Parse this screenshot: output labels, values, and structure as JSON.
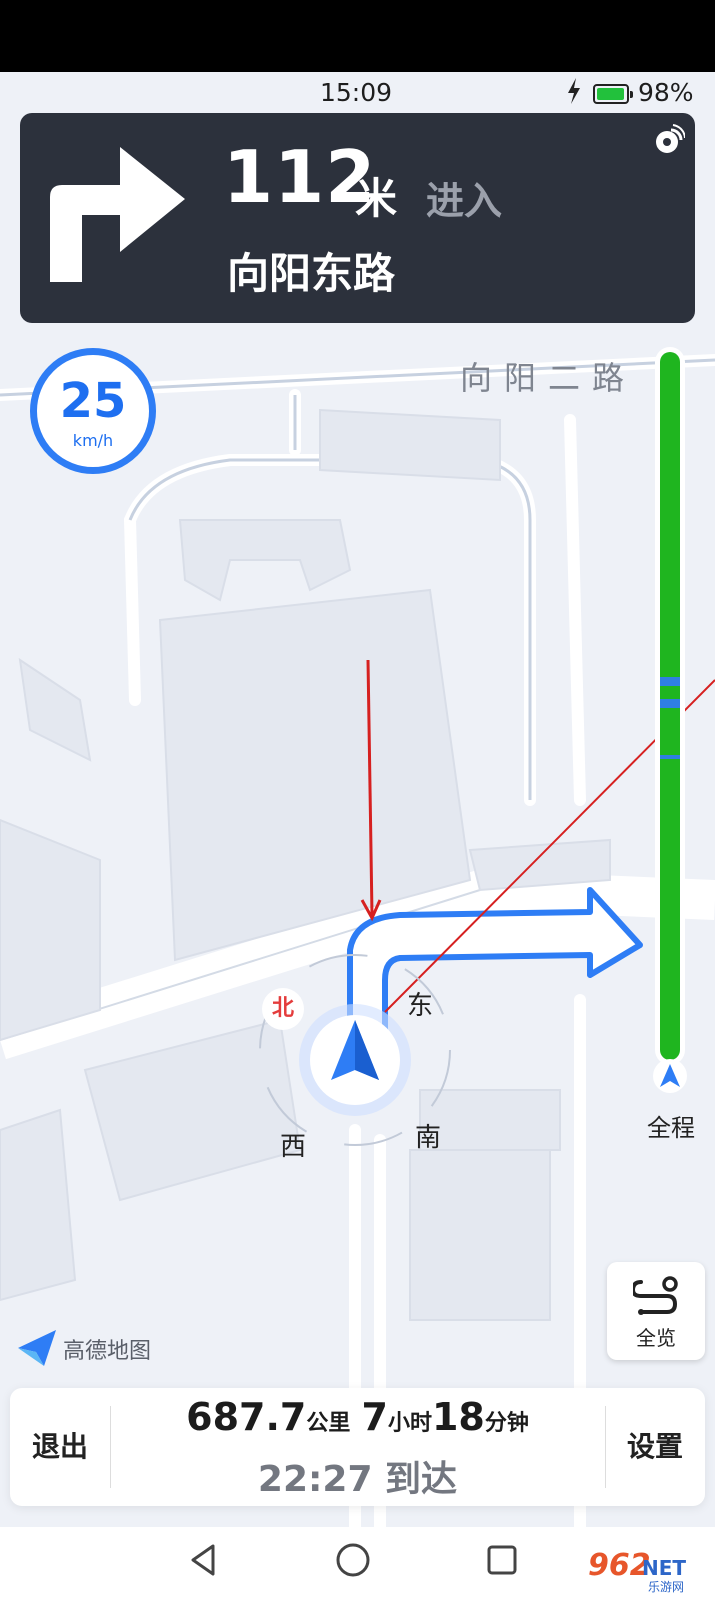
{
  "status_bar": {
    "time": "15:09",
    "battery": "98%",
    "battery_level": 0.98
  },
  "nav_instruction": {
    "distance": "112",
    "distance_unit": "米",
    "action": "进入",
    "road": "向阳东路",
    "turn_icon": "turn-right-arrow-icon",
    "voice_icon": "voice-broadcast-icon"
  },
  "speed": {
    "value": "25",
    "unit": "km/h"
  },
  "map": {
    "street_label": "向阳二路"
  },
  "compass": {
    "north": "北",
    "east": "东",
    "south": "南",
    "west": "西"
  },
  "route_progress": {
    "label": "全程"
  },
  "brand": {
    "logo_text": "高德地图"
  },
  "overview_button": {
    "label": "全览",
    "icon": "route-overview-icon"
  },
  "trip_summary": {
    "distance": "687.7",
    "distance_unit": "公里",
    "hours": "7",
    "hours_unit": "小时",
    "minutes": "18",
    "minutes_unit": "分钟",
    "arrival": "22:27 到达"
  },
  "buttons": {
    "exit": "退出",
    "settings": "设置"
  },
  "watermark": {
    "brand": "962",
    "suffix": "NET",
    "caption": "乐游网"
  },
  "colors": {
    "accent": "#2e7df5",
    "route_green": "#1fb51f",
    "card_dark": "#2c313c",
    "annotation_red": "#d62020"
  }
}
